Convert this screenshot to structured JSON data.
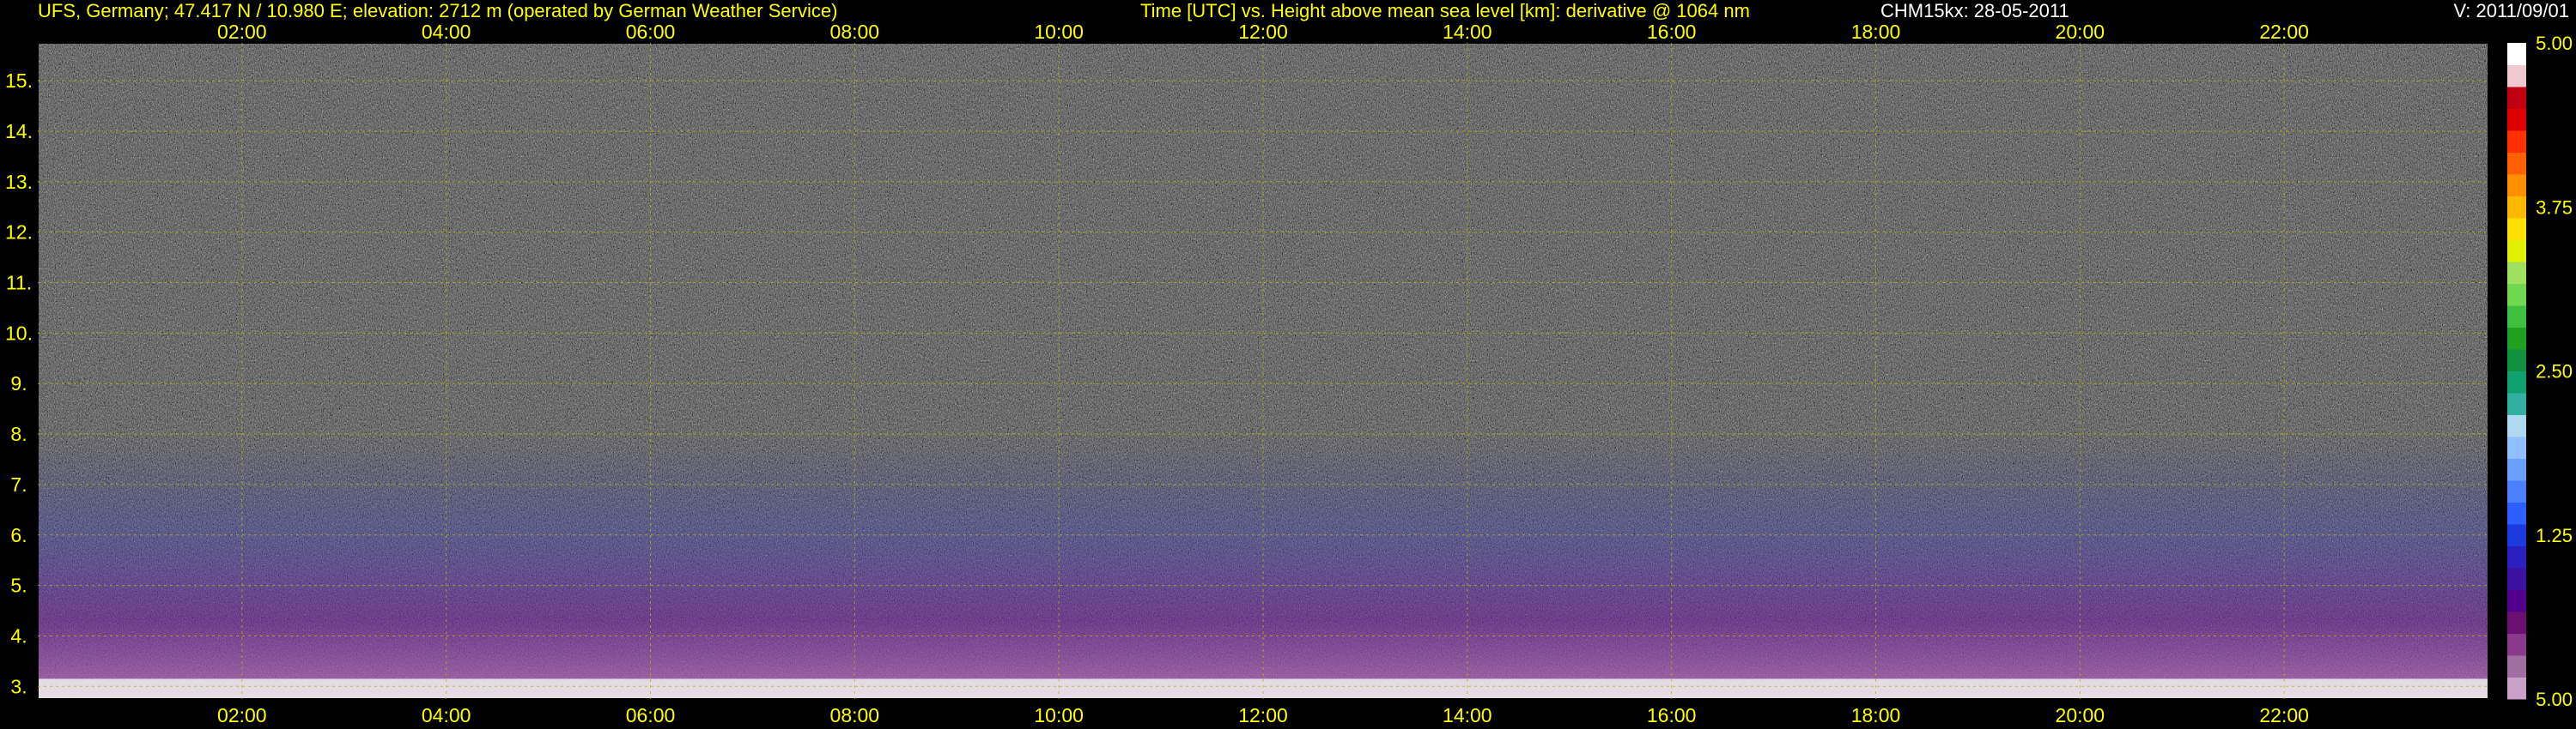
{
  "header": {
    "station": "UFS, Germany; 47.417 N / 10.980 E; elevation: 2712 m  (operated by German Weather Service)",
    "axes_description": "Time [UTC] vs. Height above mean sea level [km]: derivative @ 1064 nm",
    "instrument_date": "CHM15kx: 28-05-2011",
    "version": "V: 2011/09/01"
  },
  "colors": {
    "text": "#ffff00",
    "grid": "#b8b800",
    "background": "#000000"
  },
  "chart_data": {
    "type": "heatmap",
    "x_ticks": [
      "02:00",
      "04:00",
      "06:00",
      "08:00",
      "10:00",
      "12:00",
      "14:00",
      "16:00",
      "18:00",
      "20:00",
      "22:00"
    ],
    "x_tick_hours": [
      2,
      4,
      6,
      8,
      10,
      12,
      14,
      16,
      18,
      20,
      22
    ],
    "xlim_hours": [
      0,
      24
    ],
    "y_ticks": [
      3,
      4,
      5,
      6,
      7,
      8,
      9,
      10,
      11,
      12,
      13,
      14,
      15
    ],
    "ylim": [
      2.75,
      15.75
    ],
    "grid": true,
    "colorbar": {
      "ticks": [
        "5.00",
        "3.75",
        "2.50",
        "1.25",
        "5.00"
      ],
      "tick_positions": [
        1.0,
        0.75,
        0.5,
        0.25,
        0.0
      ],
      "colors": [
        "#c8a0c8",
        "#a06ea0",
        "#8a3a8a",
        "#6a1070",
        "#50008a",
        "#3c10a0",
        "#2a20c0",
        "#1c3ae0",
        "#2a60ff",
        "#4a80ff",
        "#6aa0ff",
        "#90c0ff",
        "#b0d8f0",
        "#30b0a0",
        "#10a070",
        "#109040",
        "#20a020",
        "#40c040",
        "#70d850",
        "#a0e060",
        "#e0f000",
        "#ffe000",
        "#ffb800",
        "#ff9000",
        "#ff6000",
        "#ff3000",
        "#e00000",
        "#c00010",
        "#f0c8d0",
        "#ffffff"
      ]
    }
  }
}
